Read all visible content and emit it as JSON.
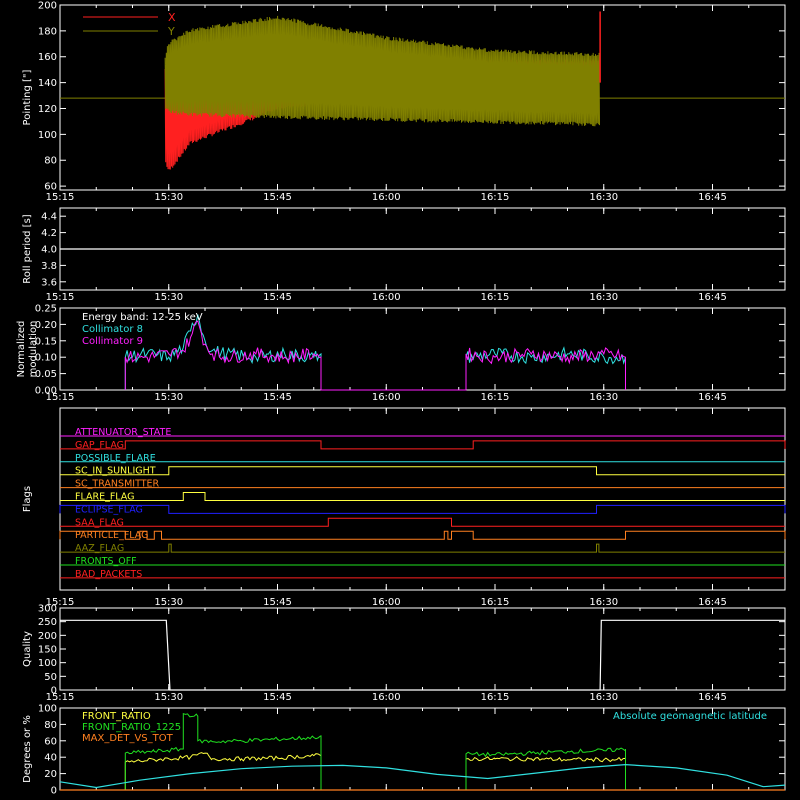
{
  "time_axis": {
    "start": "15:15",
    "end": "16:55",
    "ticks": [
      "15:15",
      "15:30",
      "15:45",
      "16:00",
      "16:15",
      "16:30",
      "16:45"
    ]
  },
  "colors": {
    "background": "#000000",
    "axes": "#ffffff",
    "red": "#ff2020",
    "olive": "#808000",
    "cyan": "#30e0e0",
    "magenta": "#ff20ff",
    "yellow": "#ffff40",
    "green": "#20e020",
    "orange": "#ff8020",
    "blue": "#2020ff"
  },
  "chart_data": [
    {
      "id": "pointing",
      "type": "line",
      "ylabel": "Pointing [\"]",
      "ylim": [
        57,
        200
      ],
      "yticks": [
        60,
        80,
        100,
        120,
        140,
        160,
        180,
        200
      ],
      "legend": {
        "position": "top-left",
        "entries": [
          {
            "label": "X",
            "color": "red"
          },
          {
            "label": "Y",
            "color": "olive"
          }
        ]
      },
      "series": [
        {
          "name": "X",
          "color": "red",
          "envelope": {
            "x": [
              "15:29:30",
              "15:30",
              "15:33",
              "15:45",
              "16:00",
              "16:15",
              "16:25",
              "16:29:30"
            ],
            "upper": [
              152,
              150,
              156,
              160,
              158,
              158,
              158,
              158
            ],
            "lower": [
              78,
              70,
              92,
              118,
              132,
              138,
              140,
              140
            ]
          }
        },
        {
          "name": "Y",
          "color": "olive",
          "envelope": {
            "x": [
              "15:29:30",
              "15:30",
              "15:33",
              "15:45",
              "16:00",
              "16:15",
              "16:25",
              "16:29:30"
            ],
            "upper": [
              162,
              172,
              182,
              192,
              176,
              166,
              164,
              163
            ],
            "lower": [
              120,
              116,
              114,
              112,
              110,
              108,
              107,
              106
            ]
          }
        }
      ],
      "baseline": {
        "value": 128,
        "color": "olive"
      },
      "spikes": [
        {
          "x": "16:29:30",
          "value": 195,
          "color": "red"
        }
      ]
    },
    {
      "id": "roll_period",
      "type": "line",
      "ylabel": "Roll period [s]",
      "ylim": [
        3.5,
        4.5
      ],
      "yticks": [
        "3.6",
        "3.8",
        "4.0",
        "4.2",
        "4.4"
      ],
      "series": [
        {
          "name": "roll",
          "color": "axes",
          "x": [
            "15:15",
            "16:55"
          ],
          "y": [
            4.0,
            4.0
          ]
        }
      ]
    },
    {
      "id": "modulation",
      "type": "line",
      "ylabel": "Normalized modulation",
      "ylim": [
        0,
        0.25
      ],
      "yticks": [
        "0.00",
        "0.05",
        "0.10",
        "0.15",
        "0.20",
        "0.25"
      ],
      "annotations": [
        {
          "text": "Energy band: 12-25 keV",
          "color": "axes"
        },
        {
          "text": "Collimator 8",
          "color": "cyan"
        },
        {
          "text": "Collimator 9",
          "color": "magenta"
        }
      ],
      "series": [
        {
          "name": "Collimator 8",
          "color": "cyan",
          "x": [
            "15:24",
            "15:24",
            "15:27",
            "15:30",
            "15:32",
            "15:33",
            "15:34",
            "15:35",
            "15:36",
            "15:38",
            "15:42",
            "15:46",
            "15:50",
            "15:51",
            "15:51",
            "16:11",
            "16:11",
            "16:15",
            "16:20",
            "16:25",
            "16:30",
            "16:33",
            "16:33"
          ],
          "y": [
            0,
            0.1,
            0.11,
            0.1,
            0.13,
            0.18,
            0.23,
            0.15,
            0.12,
            0.11,
            0.1,
            0.11,
            0.1,
            0.11,
            0,
            0,
            0.1,
            0.11,
            0.1,
            0.11,
            0.1,
            0.1,
            0
          ]
        },
        {
          "name": "Collimator 9",
          "color": "magenta",
          "x": [
            "15:24",
            "15:24",
            "15:27",
            "15:30",
            "15:32",
            "15:33",
            "15:34",
            "15:35",
            "15:36",
            "15:38",
            "15:42",
            "15:46",
            "15:50",
            "15:51",
            "15:51",
            "16:11",
            "16:11",
            "16:15",
            "16:20",
            "16:25",
            "16:30",
            "16:33",
            "16:33"
          ],
          "y": [
            0,
            0.1,
            0.1,
            0.11,
            0.12,
            0.16,
            0.21,
            0.14,
            0.11,
            0.1,
            0.11,
            0.1,
            0.11,
            0.1,
            0,
            0,
            0.11,
            0.1,
            0.11,
            0.1,
            0.11,
            0.1,
            0
          ]
        }
      ]
    },
    {
      "id": "flags",
      "type": "line",
      "ylabel": "Flags",
      "flags": [
        {
          "label": "ATTENUATOR_STATE",
          "color": "magenta",
          "steps": []
        },
        {
          "label": "GAP_FLAG",
          "color": "red",
          "steps": [
            [
              "15:24",
              "15:51"
            ],
            [
              "16:12",
              "16:55"
            ]
          ]
        },
        {
          "label": "POSSIBLE_FLARE",
          "color": "cyan",
          "steps": []
        },
        {
          "label": "SC_IN_SUNLIGHT",
          "color": "yellow",
          "steps": [
            [
              "15:30",
              "16:29"
            ]
          ]
        },
        {
          "label": "SC_TRANSMITTER",
          "color": "orange",
          "steps": []
        },
        {
          "label": "FLARE_FLAG",
          "color": "yellow",
          "steps": [
            [
              "15:32",
              "15:35"
            ]
          ]
        },
        {
          "label": "ECLIPSE_FLAG",
          "color": "blue",
          "steps": [
            [
              "15:15",
              "15:30"
            ],
            [
              "16:29",
              "16:55"
            ]
          ]
        },
        {
          "label": "SAA_FLAG",
          "color": "red",
          "steps": [
            [
              "15:52",
              "16:09"
            ]
          ]
        },
        {
          "label": "PARTICLE_FLAG",
          "color": "orange",
          "steps": [
            [
              "15:15",
              "15:24"
            ],
            [
              "15:26",
              "15:27"
            ],
            [
              "15:28",
              "15:29"
            ],
            [
              "16:08",
              "16:08:30"
            ],
            [
              "16:09",
              "16:12"
            ],
            [
              "16:33",
              "16:55"
            ]
          ]
        },
        {
          "label": "AAZ_FLAG",
          "color": "olive",
          "steps": [
            [
              "15:30",
              "15:30:20"
            ],
            [
              "16:29",
              "16:29:20"
            ]
          ]
        },
        {
          "label": "FRONTS_OFF",
          "color": "green",
          "steps": []
        },
        {
          "label": "BAD_PACKETS",
          "color": "red",
          "steps": []
        }
      ]
    },
    {
      "id": "quality",
      "type": "line",
      "ylabel": "Quality",
      "ylim": [
        0,
        300
      ],
      "yticks": [
        0,
        50,
        100,
        150,
        200,
        250,
        300
      ],
      "series": [
        {
          "name": "quality",
          "color": "axes",
          "x": [
            "15:15",
            "15:29:40",
            "15:30:10",
            "16:29:30",
            "16:29:40",
            "16:55"
          ],
          "y": [
            255,
            255,
            0,
            0,
            255,
            255
          ]
        }
      ]
    },
    {
      "id": "ratios",
      "type": "line",
      "ylabel": "Degrees or %",
      "ylim": [
        0,
        100
      ],
      "yticks": [
        0,
        20,
        40,
        60,
        80,
        100
      ],
      "legend": {
        "position": "top-left",
        "entries": [
          {
            "label": "FRONT_RATIO",
            "color": "yellow"
          },
          {
            "label": "FRONT_RATIO_1225",
            "color": "green"
          },
          {
            "label": "MAX_DET_VS_TOT",
            "color": "orange"
          }
        ]
      },
      "right_annotation": {
        "text": "Absolute geomagnetic latitude",
        "color": "cyan"
      },
      "series": [
        {
          "name": "FRONT_RATIO",
          "color": "yellow",
          "x": [
            "15:24",
            "15:24",
            "15:28",
            "15:33",
            "15:35",
            "15:36",
            "15:40",
            "15:45",
            "15:50",
            "15:51",
            "15:51",
            "16:11",
            "16:11",
            "16:15",
            "16:20",
            "16:25",
            "16:30",
            "16:33",
            "16:33"
          ],
          "y": [
            0,
            34,
            37,
            40,
            45,
            38,
            38,
            39,
            42,
            42,
            0,
            0,
            38,
            38,
            38,
            37,
            37,
            37,
            0
          ]
        },
        {
          "name": "FRONT_RATIO_1225",
          "color": "green",
          "x": [
            "15:24",
            "15:24",
            "15:28",
            "15:32",
            "15:32",
            "15:34",
            "15:34",
            "15:36",
            "15:40",
            "15:45",
            "15:50",
            "15:51",
            "15:51",
            "16:11",
            "16:11",
            "16:15",
            "16:20",
            "16:25",
            "16:30",
            "16:33",
            "16:33"
          ],
          "y": [
            0,
            45,
            47,
            50,
            93,
            90,
            60,
            59,
            60,
            62,
            64,
            66,
            0,
            0,
            44,
            43,
            45,
            47,
            48,
            50,
            0
          ]
        },
        {
          "name": "MAX_DET_VS_TOT",
          "color": "orange",
          "x": [
            "15:15",
            "16:55"
          ],
          "y": [
            0,
            0
          ]
        },
        {
          "name": "Absolute geomagnetic latitude",
          "color": "cyan",
          "x": [
            "15:15",
            "15:20",
            "15:26",
            "15:33",
            "15:40",
            "15:47",
            "15:54",
            "16:00",
            "16:07",
            "16:14",
            "16:20",
            "16:27",
            "16:33",
            "16:40",
            "16:47",
            "16:52",
            "16:55"
          ],
          "y": [
            10,
            3,
            12,
            20,
            26,
            29,
            30,
            27,
            19,
            14,
            20,
            27,
            31,
            27,
            18,
            4,
            6
          ]
        }
      ]
    }
  ]
}
